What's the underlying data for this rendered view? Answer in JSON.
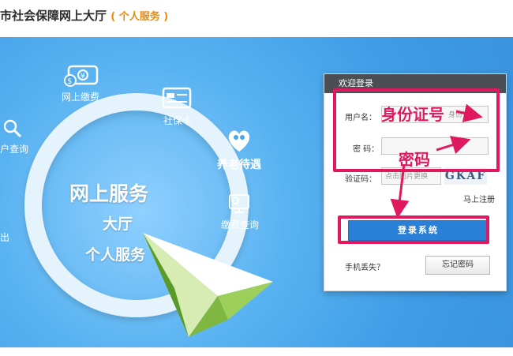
{
  "header": {
    "title": "市社会保障网上大厅",
    "subtitle": "( 个人服务 )"
  },
  "hero": {
    "line1": "网上服务",
    "line2": "大厅",
    "line3": "个人服务"
  },
  "features": [
    {
      "label": "网上缴费",
      "icon": "money-icon"
    },
    {
      "label": "社保卡",
      "icon": "card-icon"
    },
    {
      "label": "养老待遇",
      "icon": "elderly-care-icon"
    },
    {
      "label": "缴费查询",
      "icon": "query-screen-icon"
    },
    {
      "label": "户查询",
      "icon": "search-icon"
    },
    {
      "label": "出",
      "icon": "none"
    }
  ],
  "login": {
    "panel_title": "欢迎登录",
    "username_label": "用户名：",
    "username_placeholder": "身份证号",
    "password_label": "密 码：",
    "captcha_label": "验证码：",
    "captcha_placeholder": "点击图片更换",
    "captcha_text": "GKAF",
    "register": "马上注册",
    "login_button": "登录系统",
    "lost_phone": "手机丢失？",
    "forgot_password": "忘记密码"
  },
  "annotations": {
    "id_number": "身份证号",
    "password": "密码"
  },
  "colors": {
    "accent": "#f08a00",
    "banner": "#4aa6ea",
    "annotation": "#e0195e",
    "button": "#2a7fd6"
  }
}
